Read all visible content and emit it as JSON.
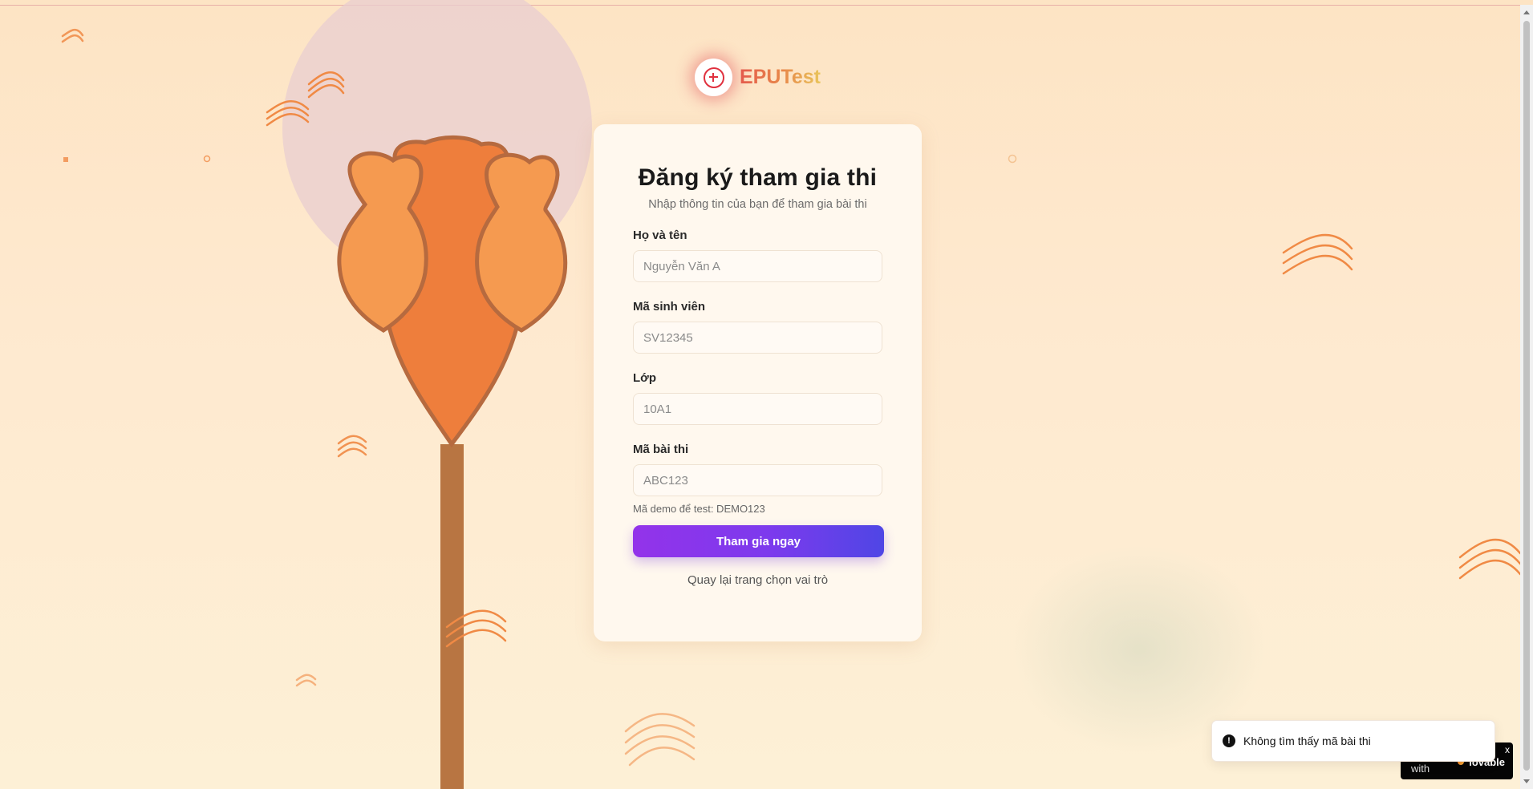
{
  "brand": {
    "name": "EPUTest",
    "logo_icon": "plus-circle-icon"
  },
  "form": {
    "title": "Đăng ký tham gia thi",
    "subtitle": "Nhập thông tin của bạn để tham gia bài thi",
    "fields": [
      {
        "label": "Họ và tên",
        "placeholder": "Nguyễn Văn A",
        "value": ""
      },
      {
        "label": "Mã sinh viên",
        "placeholder": "SV12345",
        "value": ""
      },
      {
        "label": "Lớp",
        "placeholder": "10A1",
        "value": ""
      },
      {
        "label": "Mã bài thi",
        "placeholder": "ABC123",
        "value": ""
      }
    ],
    "hint": "Mã demo để test: DEMO123",
    "submit_label": "Tham gia ngay",
    "back_label": "Quay lại trang chọn vai trò"
  },
  "toast": {
    "icon": "alert-circle-icon",
    "message": "Không tìm thấy mã bài thi"
  },
  "badge": {
    "prefix": "with",
    "brand": "lovable",
    "close_label": "x"
  },
  "colors": {
    "background": "#fde4c4",
    "accent_start": "#9333ea",
    "accent_end": "#4f46e5",
    "brand_red": "#e0313f",
    "illustration_orange": "#f08a45"
  }
}
